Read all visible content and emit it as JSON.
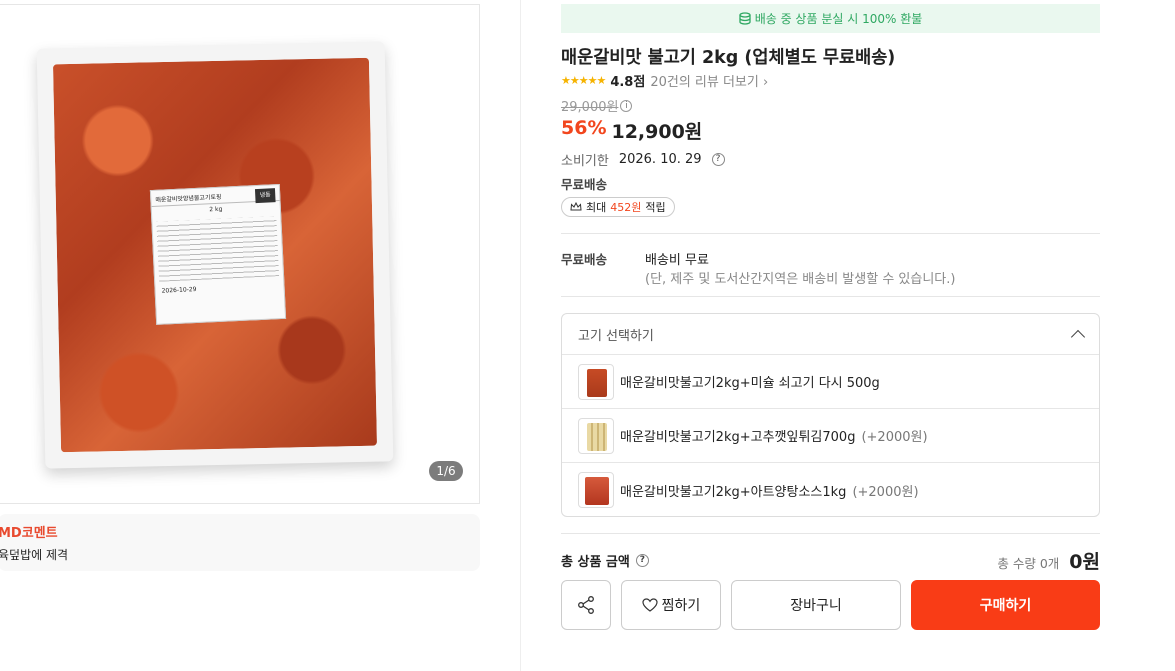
{
  "gallery": {
    "counter": "1/6",
    "label_title": "매운갈비맛양념불고기토핑",
    "label_freeze": "냉동",
    "label_weight": "2 kg",
    "label_date": "2026-10-29"
  },
  "md": {
    "title": "MD코멘트",
    "text": "육덮밥에 제격"
  },
  "banner": {
    "text": "배송 중 상품 분실 시 100% 환불"
  },
  "product": {
    "title": "매운갈비맛 불고기 2kg (업체별도 무료배송)",
    "stars": "★★★★★",
    "rating": "4.8점",
    "reviews": "20건의 리뷰 더보기",
    "original_price": "29,000원",
    "discount": "56%",
    "price": "12,900원",
    "expiry_label": "소비기한",
    "expiry_date": "2026. 10. 29",
    "free_shipping": "무료배송",
    "points_prefix": "최대",
    "points_value": "452원",
    "points_suffix": "적립"
  },
  "shipping": {
    "label": "무료배송",
    "value": "배송비 무료",
    "note": "(단, 제주 및 도서산간지역은 배송비 발생할 수 있습니다.)"
  },
  "options": {
    "header": "고기 선택하기",
    "items": [
      {
        "name": "매운갈비맛불고기2kg+미슐 쇠고기 다시 500g",
        "extra": ""
      },
      {
        "name": "매운갈비맛불고기2kg+고추깻잎튀김700g",
        "extra": "(+2000원)"
      },
      {
        "name": "매운갈비맛불고기2kg+아트양탕소스1kg",
        "extra": "(+2000원)"
      }
    ]
  },
  "summary": {
    "label": "총 상품 금액",
    "qty": "총 수량 0개",
    "total": "0원"
  },
  "buttons": {
    "wish": "찜하기",
    "cart": "장바구니",
    "buy": "구매하기"
  },
  "colors": {
    "accent": "#f93c16",
    "banner_bg": "#eaf8ef",
    "banner_text": "#2fa862",
    "star": "#f6b300"
  }
}
